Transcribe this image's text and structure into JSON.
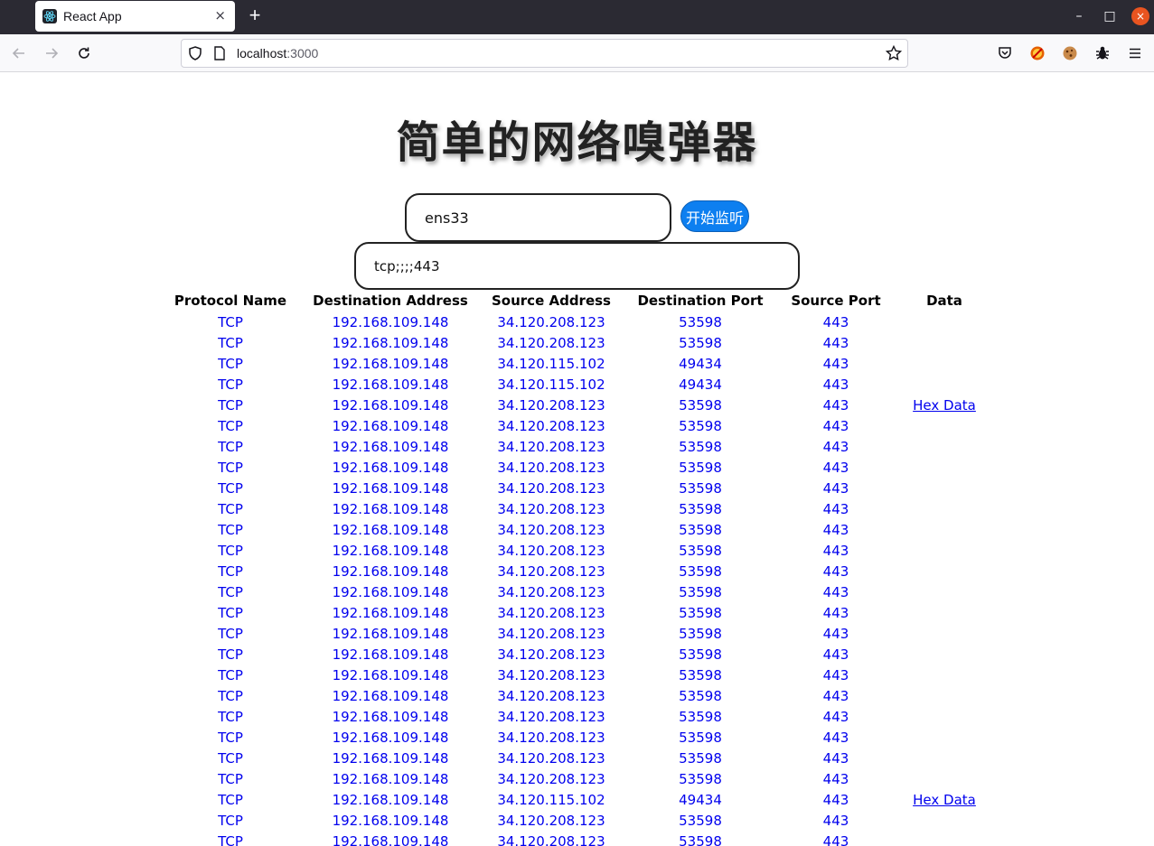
{
  "browser": {
    "tab_title": "React App",
    "tab_close": "×",
    "new_tab": "+",
    "url_host": "localhost",
    "url_port": ":3000",
    "window_controls": {
      "minimize": "–",
      "maximize": "□",
      "close": "×"
    }
  },
  "app": {
    "title": "简单的网络嗅弹器",
    "interface_value": "ens33",
    "start_button_label": "开始监听",
    "filter_value": "tcp;;;;443"
  },
  "table": {
    "columns": [
      "Protocol Name",
      "Destination Address",
      "Source Address",
      "Destination Port",
      "Source Port",
      "Data"
    ],
    "rows": [
      [
        "TCP",
        "192.168.109.148",
        "34.120.208.123",
        "53598",
        "443",
        ""
      ],
      [
        "TCP",
        "192.168.109.148",
        "34.120.208.123",
        "53598",
        "443",
        ""
      ],
      [
        "TCP",
        "192.168.109.148",
        "34.120.115.102",
        "49434",
        "443",
        ""
      ],
      [
        "TCP",
        "192.168.109.148",
        "34.120.115.102",
        "49434",
        "443",
        ""
      ],
      [
        "TCP",
        "192.168.109.148",
        "34.120.208.123",
        "53598",
        "443",
        "Hex Data"
      ],
      [
        "TCP",
        "192.168.109.148",
        "34.120.208.123",
        "53598",
        "443",
        ""
      ],
      [
        "TCP",
        "192.168.109.148",
        "34.120.208.123",
        "53598",
        "443",
        ""
      ],
      [
        "TCP",
        "192.168.109.148",
        "34.120.208.123",
        "53598",
        "443",
        ""
      ],
      [
        "TCP",
        "192.168.109.148",
        "34.120.208.123",
        "53598",
        "443",
        ""
      ],
      [
        "TCP",
        "192.168.109.148",
        "34.120.208.123",
        "53598",
        "443",
        ""
      ],
      [
        "TCP",
        "192.168.109.148",
        "34.120.208.123",
        "53598",
        "443",
        ""
      ],
      [
        "TCP",
        "192.168.109.148",
        "34.120.208.123",
        "53598",
        "443",
        ""
      ],
      [
        "TCP",
        "192.168.109.148",
        "34.120.208.123",
        "53598",
        "443",
        ""
      ],
      [
        "TCP",
        "192.168.109.148",
        "34.120.208.123",
        "53598",
        "443",
        ""
      ],
      [
        "TCP",
        "192.168.109.148",
        "34.120.208.123",
        "53598",
        "443",
        ""
      ],
      [
        "TCP",
        "192.168.109.148",
        "34.120.208.123",
        "53598",
        "443",
        ""
      ],
      [
        "TCP",
        "192.168.109.148",
        "34.120.208.123",
        "53598",
        "443",
        ""
      ],
      [
        "TCP",
        "192.168.109.148",
        "34.120.208.123",
        "53598",
        "443",
        ""
      ],
      [
        "TCP",
        "192.168.109.148",
        "34.120.208.123",
        "53598",
        "443",
        ""
      ],
      [
        "TCP",
        "192.168.109.148",
        "34.120.208.123",
        "53598",
        "443",
        ""
      ],
      [
        "TCP",
        "192.168.109.148",
        "34.120.208.123",
        "53598",
        "443",
        ""
      ],
      [
        "TCP",
        "192.168.109.148",
        "34.120.208.123",
        "53598",
        "443",
        ""
      ],
      [
        "TCP",
        "192.168.109.148",
        "34.120.208.123",
        "53598",
        "443",
        ""
      ],
      [
        "TCP",
        "192.168.109.148",
        "34.120.115.102",
        "49434",
        "443",
        "Hex Data"
      ],
      [
        "TCP",
        "192.168.109.148",
        "34.120.208.123",
        "53598",
        "443",
        ""
      ],
      [
        "TCP",
        "192.168.109.148",
        "34.120.208.123",
        "53598",
        "443",
        ""
      ]
    ]
  }
}
